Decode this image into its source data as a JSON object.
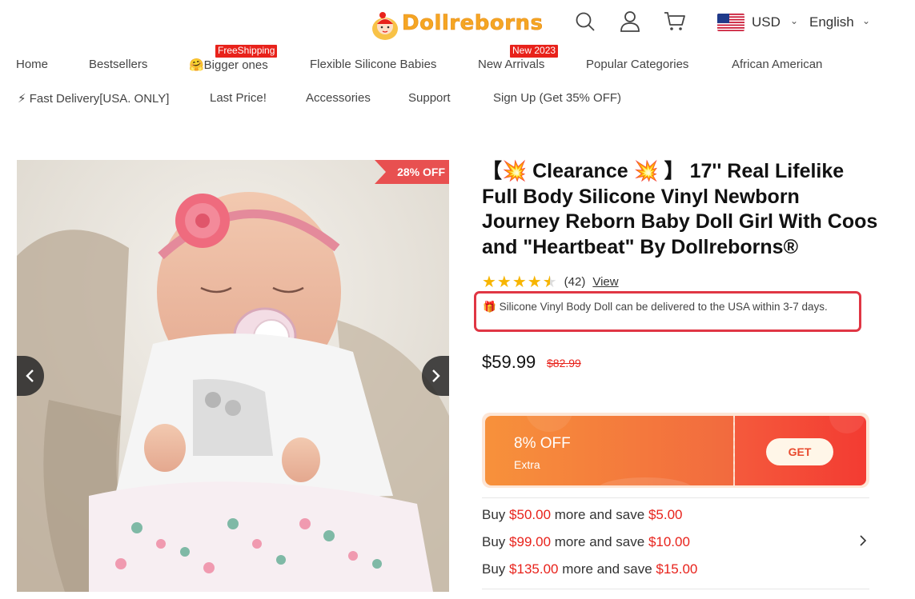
{
  "header": {
    "logo_text": "Dollreborns",
    "icons": [
      "search-icon",
      "user-icon",
      "cart-icon"
    ],
    "currency": "USD",
    "language": "English"
  },
  "nav": {
    "row1": [
      {
        "label": "Home"
      },
      {
        "label": "Bestsellers"
      },
      {
        "label": "🤗Bigger ones",
        "badge": "FreeShipping"
      },
      {
        "label": "Flexible Silicone Babies"
      },
      {
        "label": "New Arrivals",
        "badge": "New 2023"
      },
      {
        "label": "Popular Categories"
      },
      {
        "label": "African American"
      }
    ],
    "row2": [
      {
        "label": "⚡ Fast Delivery[USA. ONLY]"
      },
      {
        "label": "Last Price!"
      },
      {
        "label": "Accessories"
      },
      {
        "label": "Support"
      },
      {
        "label": "Sign Up (Get 35% OFF)"
      }
    ]
  },
  "gallery": {
    "discount_tag": "28% OFF",
    "prev_icon": "chevron-left-icon",
    "next_icon": "chevron-right-icon"
  },
  "product": {
    "title_open": "【",
    "title_burst": "💥",
    "title_clearance": " Clearance ",
    "title_close": " 】",
    "title_rest": "17'' Real Lifelike Full Body Silicone Vinyl Newborn Journey Reborn Baby Doll Girl With Coos and \"Heartbeat\" By Dollreborns®",
    "rating_stars": 4.5,
    "rating_count": "(42)",
    "rating_view": "View",
    "delivery_note": "Silicone Vinyl Body Doll can be delivered to the USA within 3-7 days.",
    "price_now": "$59.99",
    "price_old": "$82.99",
    "colors": {
      "accent_red": "#e8221b",
      "coupon_orange": "#f7913b",
      "highlight_border": "#e03644",
      "star": "#f7b500"
    }
  },
  "coupon": {
    "percent": "8% OFF",
    "extra": "Extra",
    "button": "GET"
  },
  "tiers": [
    {
      "prefix": "Buy ",
      "amount": "$50.00",
      "middle": " more and save ",
      "save": "$5.00"
    },
    {
      "prefix": "Buy ",
      "amount": "$99.00",
      "middle": " more and save ",
      "save": "$10.00"
    },
    {
      "prefix": "Buy ",
      "amount": "$135.00",
      "middle": " more and save ",
      "save": "$15.00"
    }
  ]
}
